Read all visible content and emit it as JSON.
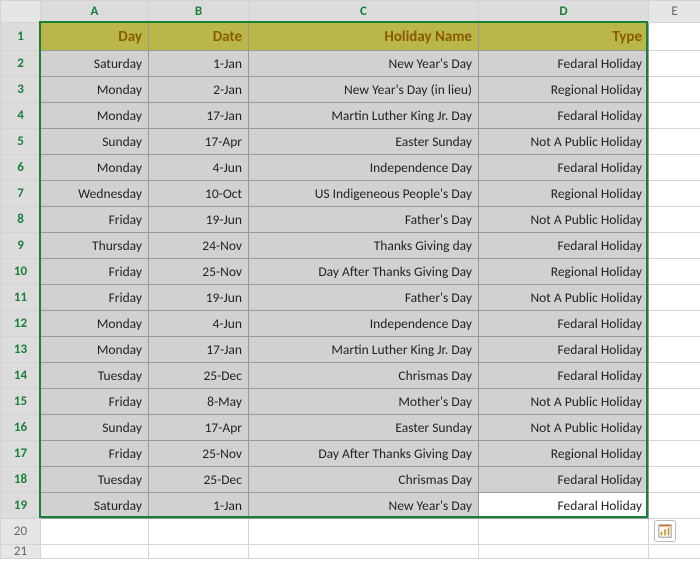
{
  "columns": [
    "A",
    "B",
    "C",
    "D",
    "E"
  ],
  "row_numbers": [
    1,
    2,
    3,
    4,
    5,
    6,
    7,
    8,
    9,
    10,
    11,
    12,
    13,
    14,
    15,
    16,
    17,
    18,
    19,
    20,
    21
  ],
  "headers": {
    "A": "Day",
    "B": "Date",
    "C": "Holiday Name",
    "D": "Type"
  },
  "rows": [
    {
      "A": "Saturday",
      "B": "1-Jan",
      "C": "New Year's Day",
      "D": "Fedaral Holiday"
    },
    {
      "A": "Monday",
      "B": "2-Jan",
      "C": "New Year's Day (in lieu)",
      "D": "Regional Holiday"
    },
    {
      "A": "Monday",
      "B": "17-Jan",
      "C": "Martin Luther King Jr. Day",
      "D": "Fedaral Holiday"
    },
    {
      "A": "Sunday",
      "B": "17-Apr",
      "C": "Easter Sunday",
      "D": "Not A Public Holiday"
    },
    {
      "A": "Monday",
      "B": "4-Jun",
      "C": "Independence Day",
      "D": "Fedaral Holiday"
    },
    {
      "A": "Wednesday",
      "B": "10-Oct",
      "C": "US Indigeneous People's Day",
      "D": "Regional Holiday"
    },
    {
      "A": "Friday",
      "B": "19-Jun",
      "C": "Father's Day",
      "D": "Not A Public Holiday"
    },
    {
      "A": "Thursday",
      "B": "24-Nov",
      "C": "Thanks Giving day",
      "D": "Fedaral Holiday"
    },
    {
      "A": "Friday",
      "B": "25-Nov",
      "C": "Day After Thanks Giving Day",
      "D": "Regional Holiday"
    },
    {
      "A": "Friday",
      "B": "19-Jun",
      "C": "Father's Day",
      "D": "Not A Public Holiday"
    },
    {
      "A": "Monday",
      "B": "4-Jun",
      "C": "Independence Day",
      "D": "Fedaral Holiday"
    },
    {
      "A": "Monday",
      "B": "17-Jan",
      "C": "Martin Luther King Jr. Day",
      "D": "Fedaral Holiday"
    },
    {
      "A": "Tuesday",
      "B": "25-Dec",
      "C": "Chrismas Day",
      "D": "Fedaral Holiday"
    },
    {
      "A": "Friday",
      "B": "8-May",
      "C": "Mother's Day",
      "D": "Not A Public Holiday"
    },
    {
      "A": "Sunday",
      "B": "17-Apr",
      "C": "Easter Sunday",
      "D": "Not A Public Holiday"
    },
    {
      "A": "Friday",
      "B": "25-Nov",
      "C": "Day After Thanks Giving Day",
      "D": "Regional Holiday"
    },
    {
      "A": "Tuesday",
      "B": "25-Dec",
      "C": "Chrismas Day",
      "D": "Fedaral Holiday"
    },
    {
      "A": "Saturday",
      "B": "1-Jan",
      "C": "New Year's Day",
      "D": "Fedaral Holiday"
    }
  ],
  "selection": {
    "from": "A1",
    "to": "D19"
  },
  "qa_icon_name": "quick-analysis-icon"
}
